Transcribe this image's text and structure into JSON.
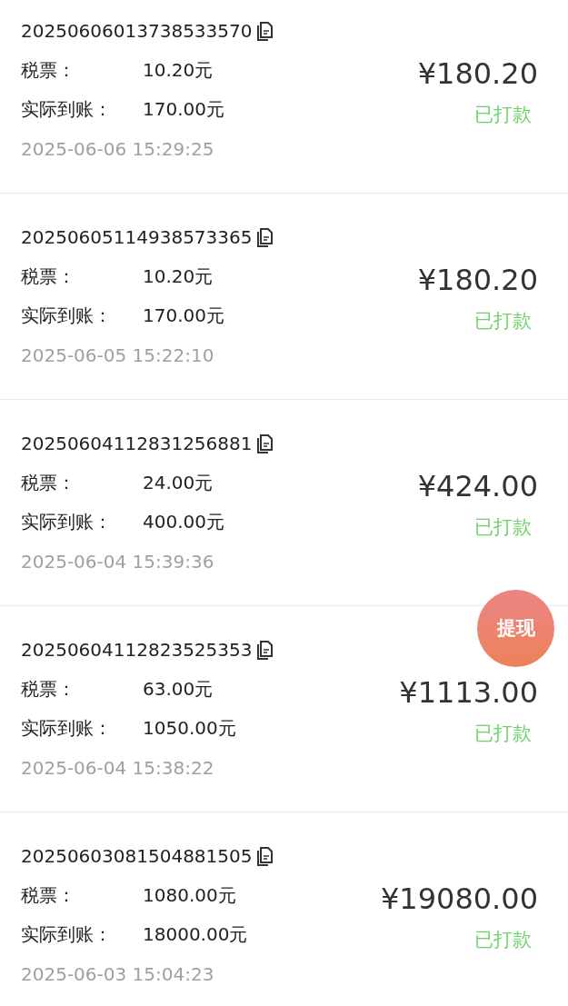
{
  "records": [
    {
      "order_no": "20250606013738533570",
      "tax_label": "税票：",
      "tax": "10.20元",
      "net_label": "实际到账：",
      "net": "170.00元",
      "time": "2025-06-06 15:29:25",
      "amount": "¥180.20",
      "status": "已打款"
    },
    {
      "order_no": "20250605114938573365",
      "tax_label": "税票：",
      "tax": "10.20元",
      "net_label": "实际到账：",
      "net": "170.00元",
      "time": "2025-06-05 15:22:10",
      "amount": "¥180.20",
      "status": "已打款"
    },
    {
      "order_no": "20250604112831256881",
      "tax_label": "税票：",
      "tax": "24.00元",
      "net_label": "实际到账：",
      "net": "400.00元",
      "time": "2025-06-04 15:39:36",
      "amount": "¥424.00",
      "status": "已打款"
    },
    {
      "order_no": "20250604112823525353",
      "tax_label": "税票：",
      "tax": "63.00元",
      "net_label": "实际到账：",
      "net": "1050.00元",
      "time": "2025-06-04 15:38:22",
      "amount": "¥1113.00",
      "status": "已打款"
    },
    {
      "order_no": "20250603081504881505",
      "tax_label": "税票：",
      "tax": "1080.00元",
      "net_label": "实际到账：",
      "net": "18000.00元",
      "time": "2025-06-03 15:04:23",
      "amount": "¥19080.00",
      "status": "已打款"
    }
  ],
  "withdraw_button": "提现"
}
